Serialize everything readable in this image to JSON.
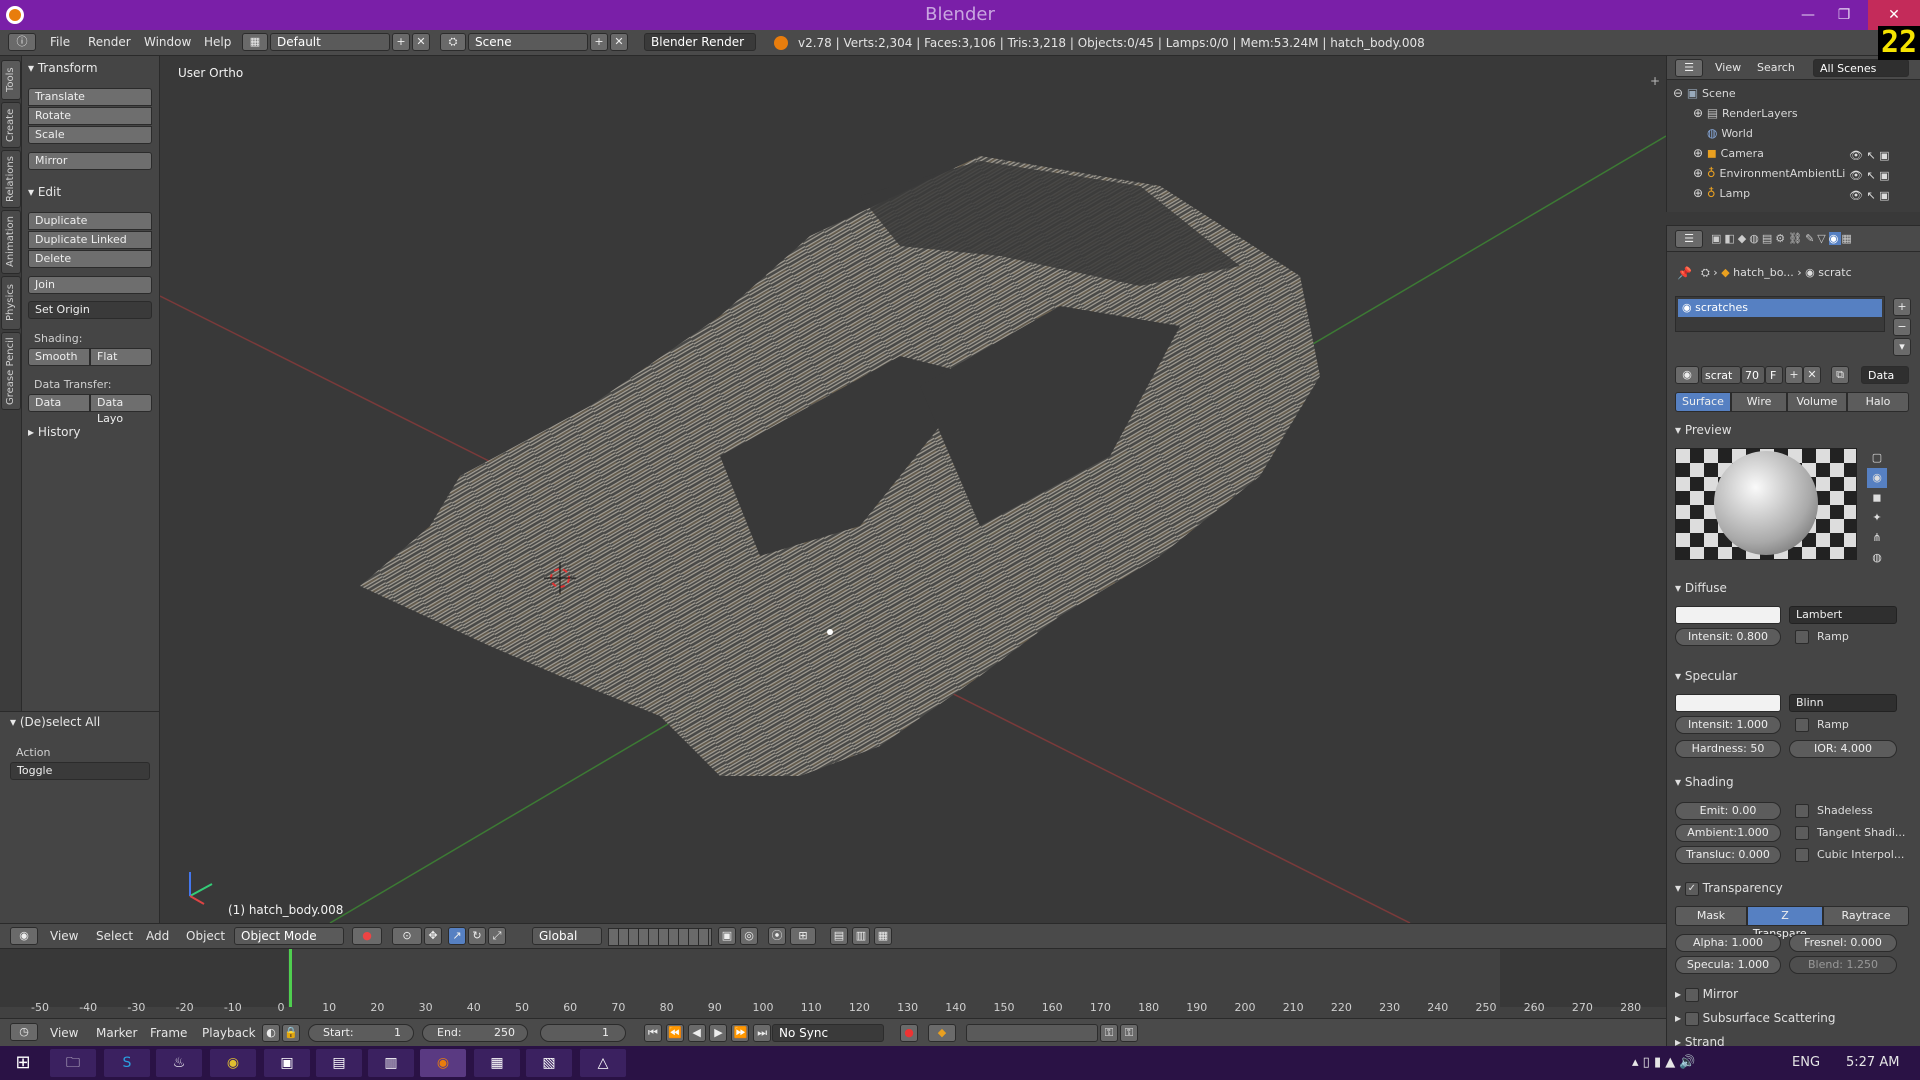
{
  "window": {
    "title": "Blender",
    "minimize": "—",
    "maximize": "❐",
    "close": "✕",
    "fps_badge": "22"
  },
  "info": {
    "menus": [
      "File",
      "Render",
      "Window",
      "Help"
    ],
    "layout": "Default",
    "scene": "Scene",
    "engine": "Blender Render",
    "stats": "v2.78 | Verts:2,304 | Faces:3,106 | Tris:3,218 | Objects:0/45 | Lamps:0/0 | Mem:53.24M | hatch_body.008"
  },
  "vtabs": [
    "Tools",
    "Create",
    "Relations",
    "Animation",
    "Physics",
    "Grease Pencil"
  ],
  "toolshelf": {
    "transform_title": "Transform",
    "transform_buttons": [
      "Translate",
      "Rotate",
      "Scale"
    ],
    "mirror": "Mirror",
    "edit_title": "Edit",
    "edit_buttons": [
      "Duplicate",
      "Duplicate Linked",
      "Delete"
    ],
    "join": "Join",
    "set_origin": "Set Origin",
    "shading_label": "Shading:",
    "smooth": "Smooth",
    "flat": "Flat",
    "data_transfer_label": "Data Transfer:",
    "data": "Data",
    "data_layout": "Data Layo",
    "history_title": "History"
  },
  "lastop": {
    "title": "(De)select All",
    "action_label": "Action",
    "action_value": "Toggle"
  },
  "viewport": {
    "view_label": "User Ortho",
    "object_label": "(1) hatch_body.008"
  },
  "header3d": {
    "menus": [
      "View",
      "Select",
      "Add",
      "Object"
    ],
    "mode": "Object Mode",
    "orientation": "Global"
  },
  "timeline": {
    "ticks": [
      "-50",
      "-40",
      "-30",
      "-20",
      "-10",
      "0",
      "10",
      "20",
      "30",
      "40",
      "50",
      "60",
      "70",
      "80",
      "90",
      "100",
      "110",
      "120",
      "130",
      "140",
      "150",
      "160",
      "170",
      "180",
      "190",
      "200",
      "210",
      "220",
      "230",
      "240",
      "250",
      "260",
      "270",
      "280"
    ],
    "current_frame_value": 0,
    "menus": [
      "View",
      "Marker",
      "Frame",
      "Playback"
    ],
    "start": "Start:",
    "start_value": "1",
    "end": "End:",
    "end_value": "250",
    "current": "1",
    "sync": "No Sync"
  },
  "outliner": {
    "menus": [
      "View",
      "Search"
    ],
    "filter": "All Scenes",
    "items": [
      {
        "label": "Scene"
      },
      {
        "label": "RenderLayers"
      },
      {
        "label": "World"
      },
      {
        "label": "Camera"
      },
      {
        "label": "EnvironmentAmbientLi"
      },
      {
        "label": "Lamp"
      }
    ]
  },
  "props": {
    "breadcrumb_obj": "hatch_bo...",
    "breadcrumb_mat": "scratc",
    "slot": "scratches",
    "mat_name": "scrat",
    "mat_users": "70",
    "fake": "F",
    "data_dropdown": "Data",
    "tabs": [
      "Surface",
      "Wire",
      "Volume",
      "Halo"
    ],
    "preview_title": "Preview",
    "diffuse": {
      "title": "Diffuse",
      "shader": "Lambert",
      "intensity": "Intensit:",
      "intensity_value": "0.800",
      "ramp": "Ramp",
      "color": "#f2f2f2"
    },
    "specular": {
      "title": "Specular",
      "shader": "Blinn",
      "intensity": "Intensit:",
      "intensity_value": "1.000",
      "ramp": "Ramp",
      "hardness": "Hardness:",
      "hardness_value": "50",
      "ior": "IOR:",
      "ior_value": "4.000",
      "color": "#f2f2f2"
    },
    "shading": {
      "title": "Shading",
      "emit": "Emit:",
      "emit_value": "0.00",
      "ambient": "Ambient:",
      "ambient_value": "1.000",
      "transluc": "Transluc:",
      "transluc_value": "0.000",
      "shadeless": "Shadeless",
      "tangent": "Tangent Shadi...",
      "cubic": "Cubic Interpol..."
    },
    "transparency": {
      "title": "Transparency",
      "modes": [
        "Mask",
        "Z Transpare...",
        "Raytrace"
      ],
      "alpha": "Alpha:",
      "alpha_value": "1.000",
      "fresnel": "Fresnel:",
      "fresnel_value": "0.000",
      "specula": "Specula:",
      "specula_value": "1.000",
      "blend": "Blend:",
      "blend_value": "1.250"
    },
    "mirror_title": "Mirror",
    "sss_title": "Subsurface Scattering",
    "strand_title": "Strand"
  },
  "taskbar": {
    "apps": [
      "Windows",
      "File Explorer",
      "Skype",
      "Steam",
      "Chrome",
      "App",
      "App",
      "App",
      "Blender",
      "App",
      "App",
      "App"
    ],
    "lang": "ENG",
    "time": "5:27 AM"
  },
  "colors": {
    "accent_blue": "#5680c2",
    "title_purple": "#7a1fa8",
    "timeline_frame": "#4fcf4f"
  }
}
